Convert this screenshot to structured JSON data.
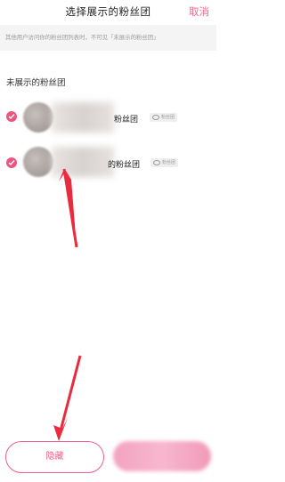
{
  "header": {
    "title": "选择展示的粉丝团",
    "cancel": "取消"
  },
  "notice": {
    "text": "其他用户访问你的粉丝团列表时，不可见「未展示的粉丝团」"
  },
  "section": {
    "title": "未展示的粉丝团"
  },
  "items": [
    {
      "name_visible": "粉丝团",
      "badge": "粉丝团"
    },
    {
      "name_visible": "的粉丝团",
      "badge": "粉丝团"
    }
  ],
  "bottom": {
    "hide_label": "隐藏"
  },
  "colors": {
    "accent": "#ee5480"
  }
}
